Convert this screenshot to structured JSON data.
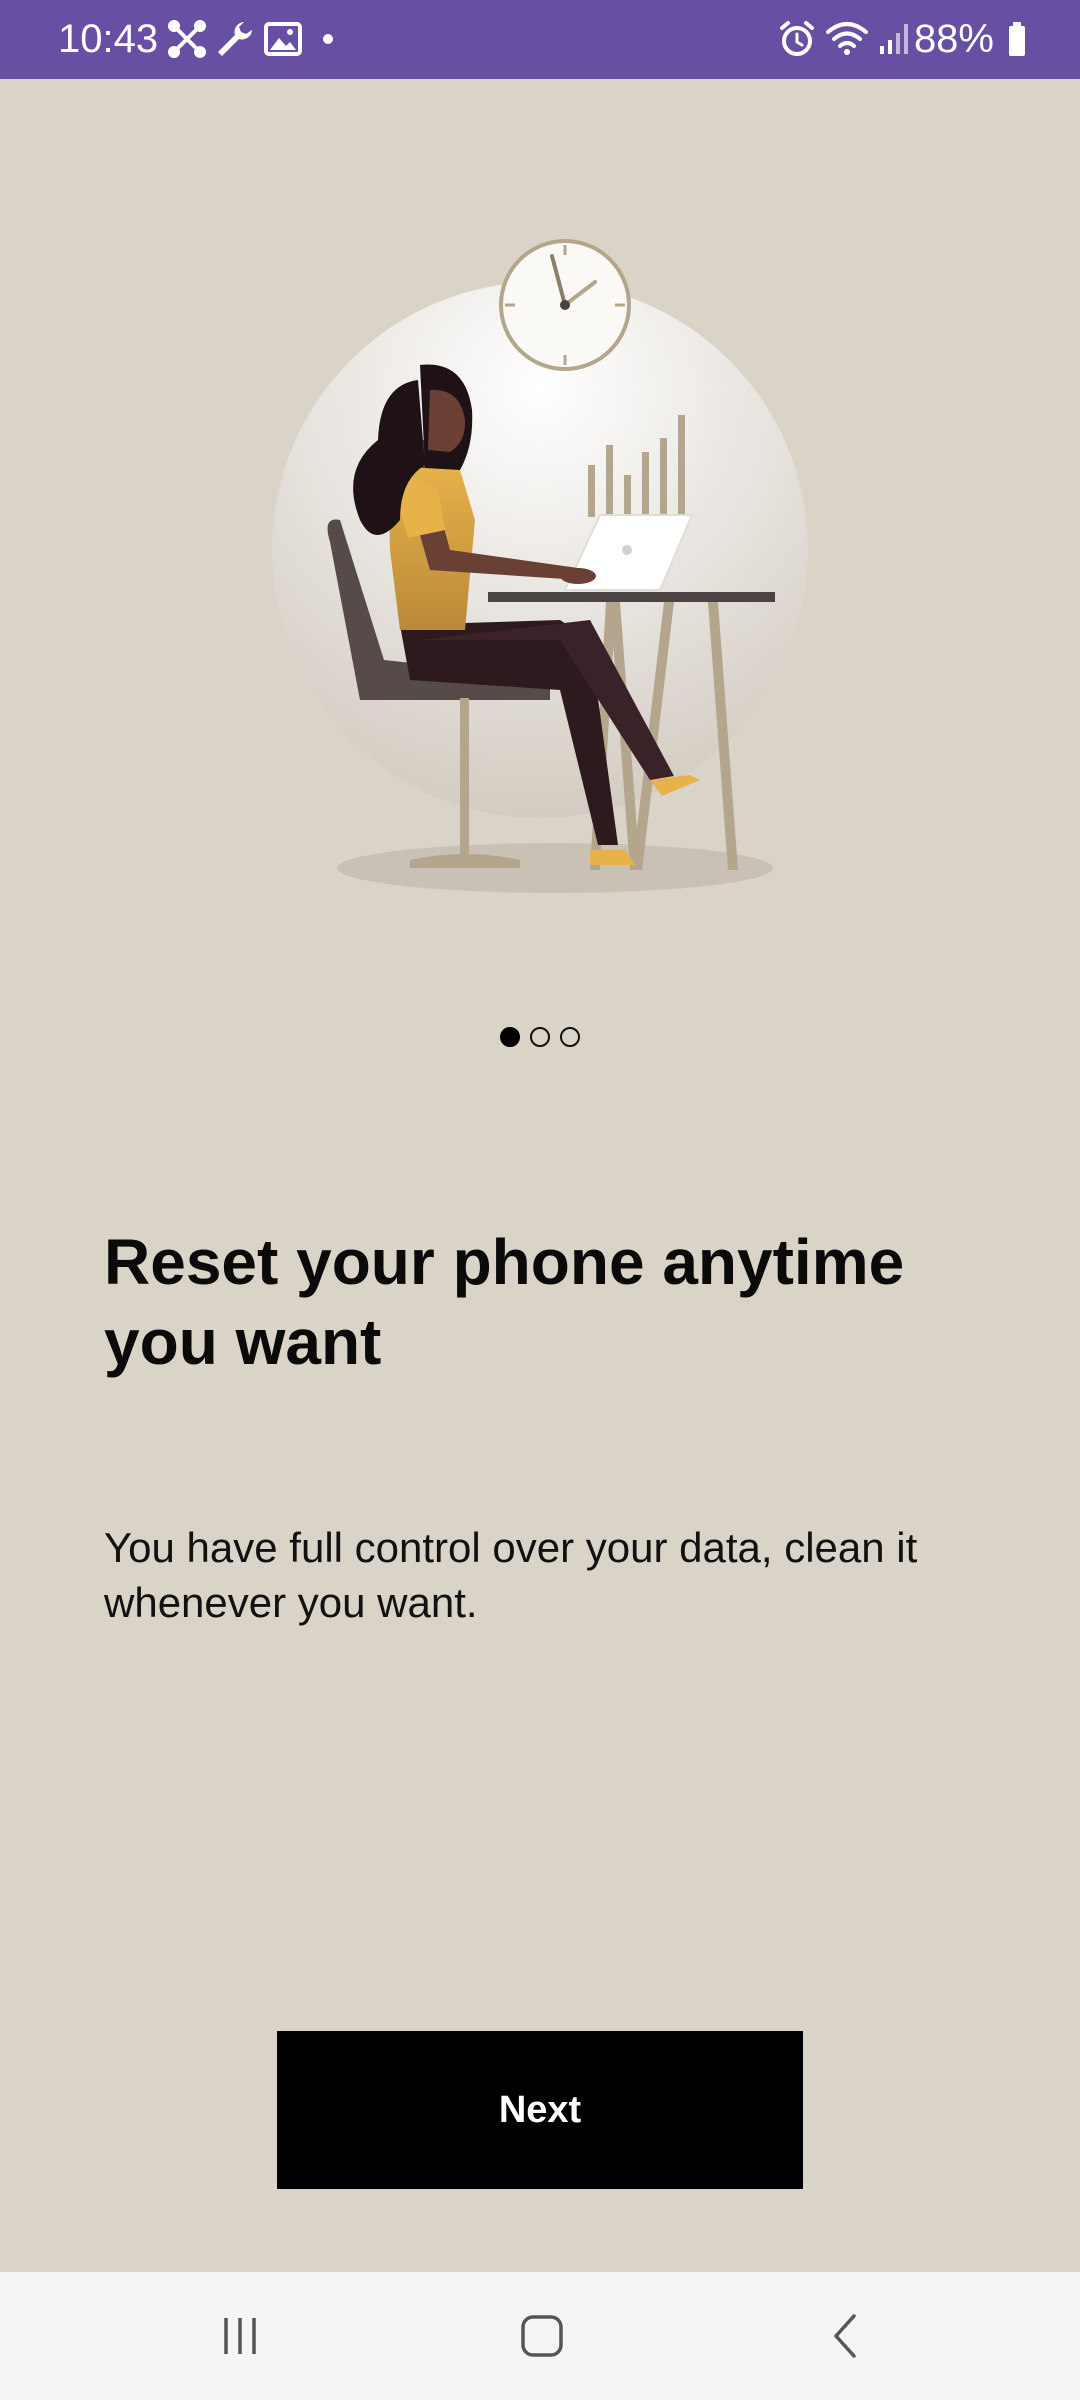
{
  "status_bar": {
    "time": "10:43",
    "battery": "88%",
    "icons": [
      "tools-icon",
      "wrench-icon",
      "image-icon",
      "dot-icon",
      "alarm-icon",
      "wifi-icon",
      "signal-icon",
      "battery-icon"
    ],
    "background": "#6750a4"
  },
  "onboarding": {
    "page_count": 3,
    "active_page": 1,
    "title": "Reset your phone anytime you want",
    "subtitle": "You have full control over your data, clean it whenever you want.",
    "next_label": "Next"
  },
  "nav_bar": {
    "buttons": [
      "recents-icon",
      "home-icon",
      "back-icon"
    ]
  },
  "colors": {
    "background": "#dad4c8",
    "button": "#000000",
    "accent_skin": "#e8b24a"
  }
}
